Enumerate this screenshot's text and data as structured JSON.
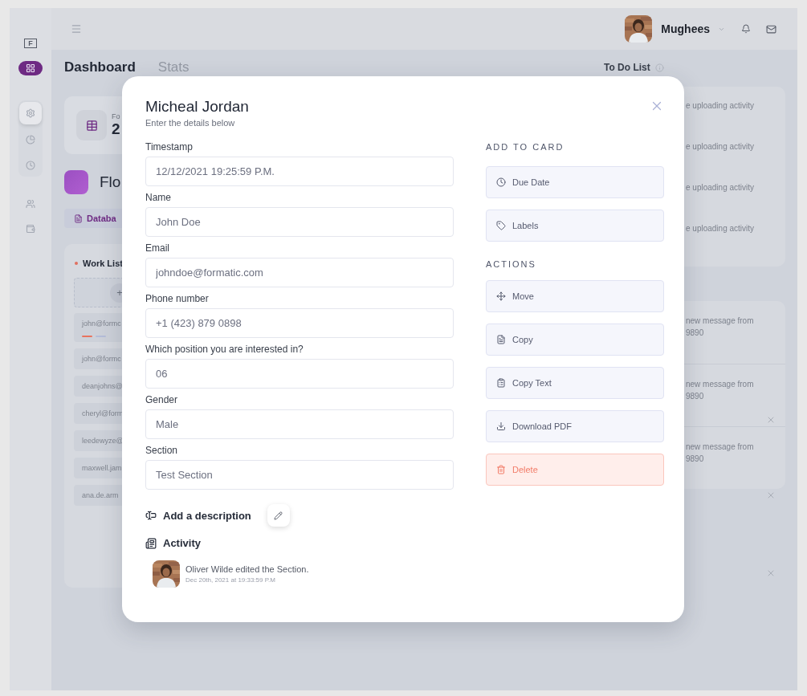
{
  "sidebar": {
    "logo": "F",
    "nav": [
      {
        "kind": "grid",
        "selected": true
      }
    ],
    "settings": [
      {
        "kind": "gear",
        "selected": true
      },
      {
        "kind": "pie",
        "selected": false
      },
      {
        "kind": "clock",
        "selected": false
      }
    ],
    "more": [
      {
        "kind": "users",
        "selected": false
      },
      {
        "kind": "wallet",
        "selected": false
      }
    ]
  },
  "header": {
    "user_name": "Mughees"
  },
  "tabs": [
    {
      "label": "Dashboard",
      "selected": true
    },
    {
      "label": "Stats",
      "selected": false
    }
  ],
  "stat_card": {
    "label": "Fo",
    "value": "2"
  },
  "flow": {
    "title": "Flo"
  },
  "chip": {
    "label": "Databa"
  },
  "work_list": {
    "title": "Work List",
    "add_label": "+",
    "items": [
      {
        "email": "john@formc",
        "tags": [
          {
            "color": "#e8735f"
          },
          {
            "color": "#b4bdd8"
          }
        ]
      },
      {
        "email": "john@formc"
      },
      {
        "email": "deanjohns@"
      },
      {
        "email": "cheryl@form"
      },
      {
        "email": "leedewyze@"
      },
      {
        "email": "maxwell.jam"
      },
      {
        "email": "ana.de.arm"
      }
    ]
  },
  "todo": {
    "title": "To Do List",
    "items": [
      "e uploading activity",
      "e uploading activity",
      "e uploading activity",
      "e uploading activity"
    ]
  },
  "messages": [
    {
      "line1": "new message from",
      "line2": "9890"
    },
    {
      "line1": "new message from",
      "line2": "9890"
    },
    {
      "line1": "new message from",
      "line2": "9890"
    }
  ],
  "modal": {
    "title": "Micheal Jordan",
    "subtitle": "Enter the details below",
    "fields": [
      {
        "label": "Timestamp",
        "value": "12/12/2021 19:25:59 P.M."
      },
      {
        "label": "Name",
        "value": "John Doe"
      },
      {
        "label": "Email",
        "value": "johndoe@formatic.com"
      },
      {
        "label": "Phone number",
        "value": "+1 (423) 879 0898"
      },
      {
        "label": "Which position you are interested in?",
        "value": "06"
      },
      {
        "label": "Gender",
        "value": "Male"
      },
      {
        "label": "Section",
        "value": "Test Section"
      }
    ],
    "add_to_card": {
      "heading": "ADD TO CARD",
      "buttons": [
        {
          "label": "Due Date",
          "kind": "due-date"
        },
        {
          "label": "Labels",
          "kind": "labels"
        }
      ]
    },
    "actions": {
      "heading": "ACTIONS",
      "buttons": [
        {
          "label": "Move",
          "kind": "move"
        },
        {
          "label": "Copy",
          "kind": "copy"
        },
        {
          "label": "Copy Text",
          "kind": "copy-text"
        },
        {
          "label": "Download PDF",
          "kind": "download"
        },
        {
          "label": "Delete",
          "kind": "delete"
        }
      ]
    },
    "description": {
      "label": "Add a description"
    },
    "activity": {
      "heading": "Activity",
      "entries": [
        {
          "text": "Oliver Wilde edited the Section.",
          "time": "Dec 20th, 2021 at 19:33:59 P.M"
        }
      ]
    }
  }
}
